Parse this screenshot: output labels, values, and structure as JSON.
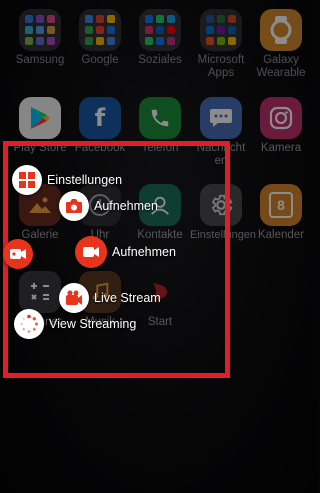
{
  "apps_row1": [
    {
      "label": "Samsung",
      "icon": "samsung-folder-icon"
    },
    {
      "label": "Google",
      "icon": "google-folder-icon"
    },
    {
      "label": "Soziales",
      "icon": "social-folder-icon"
    },
    {
      "label": "Microsoft Apps",
      "icon": "microsoft-folder-icon"
    },
    {
      "label": "Galaxy Wearable",
      "icon": "galaxy-wearable-icon"
    }
  ],
  "apps_row2": [
    {
      "label": "Play Store",
      "icon": "play-store-icon"
    },
    {
      "label": "Facebook",
      "icon": "facebook-icon"
    },
    {
      "label": "Telefon",
      "icon": "phone-icon"
    },
    {
      "label": "Nachrichten",
      "icon": "messages-icon"
    },
    {
      "label": "Kamera",
      "icon": "camera-icon"
    }
  ],
  "apps_row3": [
    {
      "label": "Galerie",
      "icon": "gallery-icon"
    },
    {
      "label": "Uhr",
      "icon": "clock-icon"
    },
    {
      "label": "Kontakte",
      "icon": "contacts-icon"
    },
    {
      "label": "Einstellungen",
      "icon": "settings-icon"
    },
    {
      "label": "Kalender",
      "icon": "calendar-icon",
      "date": "8"
    }
  ],
  "apps_row4": [
    {
      "label": "Rechner",
      "icon": "calculator-icon"
    },
    {
      "label": "Musik",
      "icon": "music-icon"
    },
    {
      "label": "Start",
      "icon": "start-icon"
    }
  ],
  "quick_actions": {
    "settings": "Einstellungen",
    "record_camera": "Aufnehmen",
    "record_screen": "Aufnehmen",
    "live_stream": "Live Stream",
    "view_streaming": "View Streaming"
  },
  "colors": {
    "highlight": "#e01e27",
    "accent_red": "#e8341c",
    "label_gray": "#9e9ea3"
  }
}
